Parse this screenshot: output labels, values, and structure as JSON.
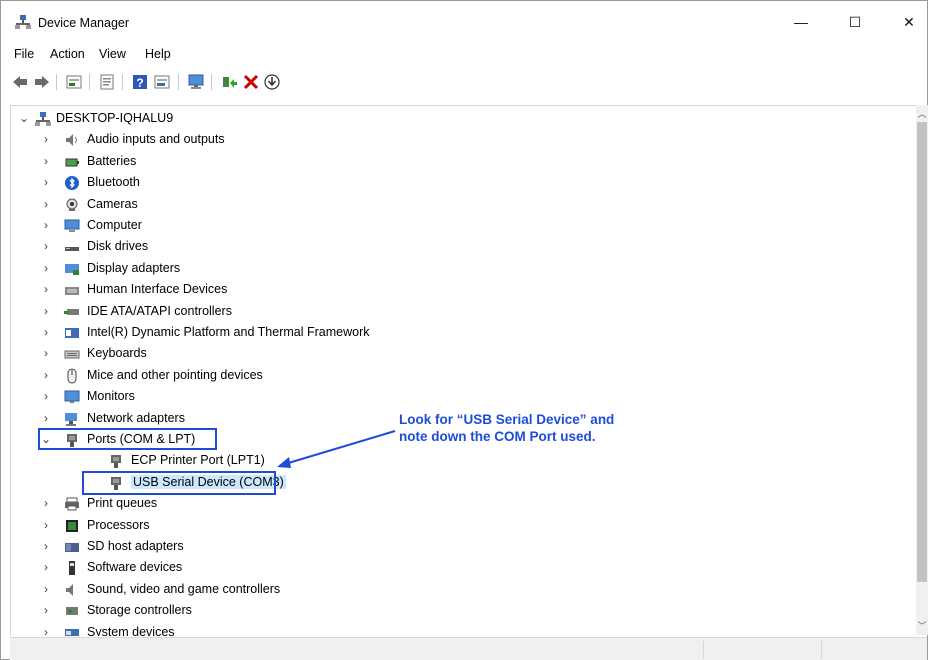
{
  "window": {
    "title": "Device Manager",
    "minimize": "—",
    "maximize": "☐",
    "close": "✕"
  },
  "menu": [
    "File",
    "Action",
    "View",
    "Help"
  ],
  "toolbar": {
    "icons": [
      "back-arrow-icon",
      "forward-arrow-icon",
      "show-hidden-icon",
      "properties-icon",
      "help-icon",
      "details-view-icon",
      "scan-hardware-icon",
      "update-driver-icon",
      "uninstall-icon",
      "download-icon"
    ]
  },
  "tree": {
    "root": "DESKTOP-IQHALU9",
    "categories": [
      {
        "label": "Audio inputs and outputs",
        "icon": "speaker-icon"
      },
      {
        "label": "Batteries",
        "icon": "battery-icon"
      },
      {
        "label": "Bluetooth",
        "icon": "bluetooth-icon"
      },
      {
        "label": "Cameras",
        "icon": "camera-icon"
      },
      {
        "label": "Computer",
        "icon": "computer-icon"
      },
      {
        "label": "Disk drives",
        "icon": "disk-drive-icon"
      },
      {
        "label": "Display adapters",
        "icon": "display-adapter-icon"
      },
      {
        "label": "Human Interface Devices",
        "icon": "hid-icon"
      },
      {
        "label": "IDE ATA/ATAPI controllers",
        "icon": "ide-controller-icon"
      },
      {
        "label": "Intel(R) Dynamic Platform and Thermal Framework",
        "icon": "intel-framework-icon"
      },
      {
        "label": "Keyboards",
        "icon": "keyboard-icon"
      },
      {
        "label": "Mice and other pointing devices",
        "icon": "mouse-icon"
      },
      {
        "label": "Monitors",
        "icon": "monitor-icon"
      },
      {
        "label": "Network adapters",
        "icon": "network-adapter-icon"
      },
      {
        "label": "Ports (COM & LPT)",
        "icon": "port-icon",
        "expanded": true
      },
      {
        "label": "Print queues",
        "icon": "printer-icon"
      },
      {
        "label": "Processors",
        "icon": "processor-icon"
      },
      {
        "label": "SD host adapters",
        "icon": "sd-adapter-icon"
      },
      {
        "label": "Software devices",
        "icon": "software-device-icon"
      },
      {
        "label": "Sound, video and game controllers",
        "icon": "sound-controller-icon"
      },
      {
        "label": "Storage controllers",
        "icon": "storage-controller-icon"
      },
      {
        "label": "System devices",
        "icon": "system-device-icon"
      }
    ],
    "ports_children": [
      {
        "label": "ECP Printer Port (LPT1)",
        "icon": "port-icon"
      },
      {
        "label": "USB Serial Device (COM3)",
        "icon": "port-icon",
        "selected": true
      }
    ]
  },
  "annotation": {
    "line1": "Look for “USB Serial Device” and",
    "line2": "note down the COM Port used."
  },
  "colors": {
    "annotation": "#1f4bdb",
    "selection": "#cce8ff"
  }
}
